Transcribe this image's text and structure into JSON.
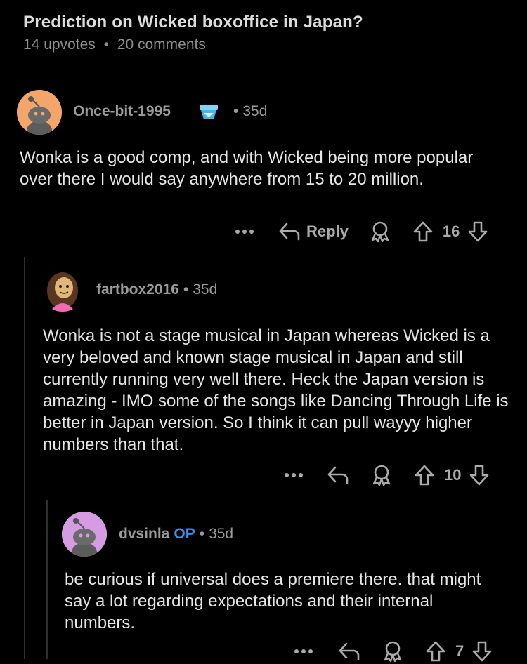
{
  "post": {
    "title": "Prediction on Wicked boxoffice in Japan?",
    "upvotes": "14 upvotes",
    "separator": "•",
    "comments": "20 comments"
  },
  "comments": [
    {
      "author": "Once-bit-1995",
      "age": "35d",
      "body": "Wonka is a good comp, and with Wicked being more popular over there I would say anywhere from 15 to 20 million.",
      "reply_label": "Reply",
      "votes": "16",
      "avatar_color": "#f3a56a"
    },
    {
      "author": "fartbox2016",
      "age": "35d",
      "body": "Wonka is not a stage musical in Japan whereas Wicked is a very beloved and known stage musical in Japan and still currently running very well there. Heck the Japan version is amazing - IMO some of the songs like Dancing Through Life is better in Japan version. So I think it can pull wayyy higher numbers than that.",
      "votes": "10",
      "avatar_color": "#f06bb4"
    },
    {
      "author": "dvsinla",
      "op_label": "OP",
      "age": "35d",
      "body": "be curious if universal does a premiere there. that might say a lot regarding expectations and their internal numbers.",
      "votes": "7",
      "avatar_color": "#d59be3"
    }
  ],
  "icons": {
    "more": "more-icon",
    "reply": "reply-icon",
    "award": "award-icon",
    "upvote": "upvote-icon",
    "downvote": "downvote-icon"
  }
}
